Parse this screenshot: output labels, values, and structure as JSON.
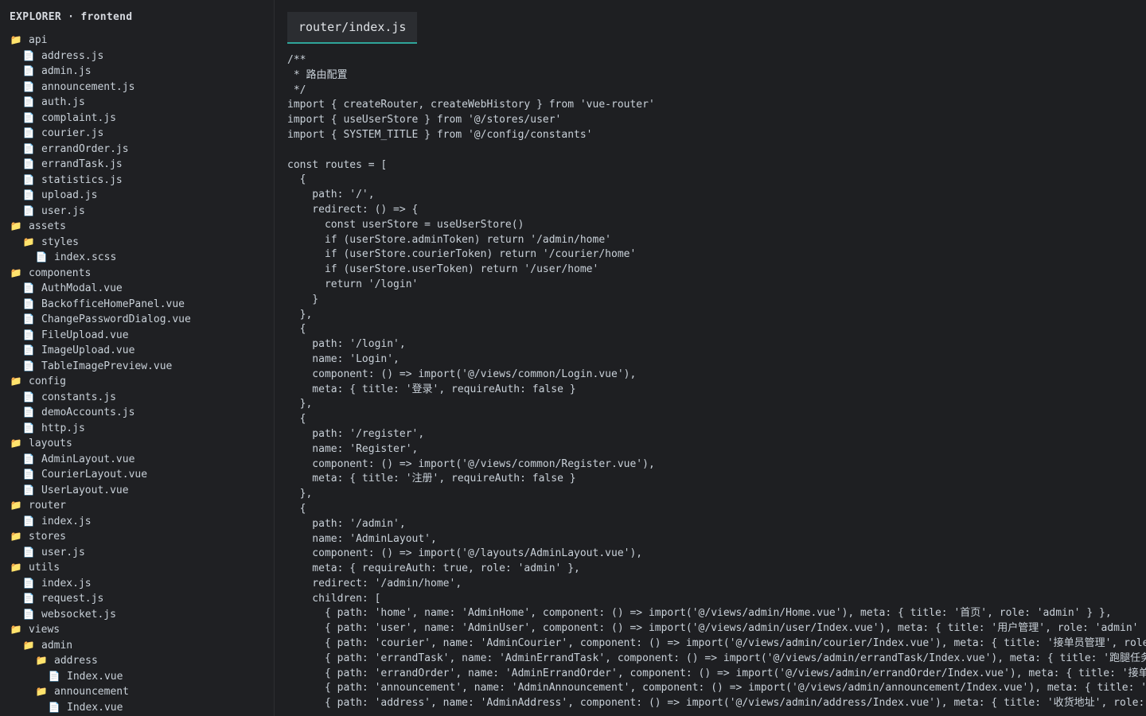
{
  "sidebar": {
    "title": "EXPLORER · frontend",
    "items": [
      {
        "label": "api",
        "type": "folder",
        "depth": 0
      },
      {
        "label": "address.js",
        "type": "file",
        "depth": 1
      },
      {
        "label": "admin.js",
        "type": "file",
        "depth": 1
      },
      {
        "label": "announcement.js",
        "type": "file",
        "depth": 1
      },
      {
        "label": "auth.js",
        "type": "file",
        "depth": 1
      },
      {
        "label": "complaint.js",
        "type": "file",
        "depth": 1
      },
      {
        "label": "courier.js",
        "type": "file",
        "depth": 1
      },
      {
        "label": "errandOrder.js",
        "type": "file",
        "depth": 1
      },
      {
        "label": "errandTask.js",
        "type": "file",
        "depth": 1
      },
      {
        "label": "statistics.js",
        "type": "file",
        "depth": 1
      },
      {
        "label": "upload.js",
        "type": "file",
        "depth": 1
      },
      {
        "label": "user.js",
        "type": "file",
        "depth": 1
      },
      {
        "label": "assets",
        "type": "folder",
        "depth": 0
      },
      {
        "label": "styles",
        "type": "folder",
        "depth": 1
      },
      {
        "label": "index.scss",
        "type": "file",
        "depth": 2
      },
      {
        "label": "components",
        "type": "folder",
        "depth": 0
      },
      {
        "label": "AuthModal.vue",
        "type": "file",
        "depth": 1
      },
      {
        "label": "BackofficeHomePanel.vue",
        "type": "file",
        "depth": 1
      },
      {
        "label": "ChangePasswordDialog.vue",
        "type": "file",
        "depth": 1
      },
      {
        "label": "FileUpload.vue",
        "type": "file",
        "depth": 1
      },
      {
        "label": "ImageUpload.vue",
        "type": "file",
        "depth": 1
      },
      {
        "label": "TableImagePreview.vue",
        "type": "file",
        "depth": 1
      },
      {
        "label": "config",
        "type": "folder",
        "depth": 0
      },
      {
        "label": "constants.js",
        "type": "file",
        "depth": 1
      },
      {
        "label": "demoAccounts.js",
        "type": "file",
        "depth": 1
      },
      {
        "label": "http.js",
        "type": "file",
        "depth": 1
      },
      {
        "label": "layouts",
        "type": "folder",
        "depth": 0
      },
      {
        "label": "AdminLayout.vue",
        "type": "file",
        "depth": 1
      },
      {
        "label": "CourierLayout.vue",
        "type": "file",
        "depth": 1
      },
      {
        "label": "UserLayout.vue",
        "type": "file",
        "depth": 1
      },
      {
        "label": "router",
        "type": "folder",
        "depth": 0
      },
      {
        "label": "index.js",
        "type": "file",
        "depth": 1
      },
      {
        "label": "stores",
        "type": "folder",
        "depth": 0
      },
      {
        "label": "user.js",
        "type": "file",
        "depth": 1
      },
      {
        "label": "utils",
        "type": "folder",
        "depth": 0
      },
      {
        "label": "index.js",
        "type": "file",
        "depth": 1
      },
      {
        "label": "request.js",
        "type": "file",
        "depth": 1
      },
      {
        "label": "websocket.js",
        "type": "file",
        "depth": 1
      },
      {
        "label": "views",
        "type": "folder",
        "depth": 0
      },
      {
        "label": "admin",
        "type": "folder",
        "depth": 1
      },
      {
        "label": "address",
        "type": "folder",
        "depth": 2
      },
      {
        "label": "Index.vue",
        "type": "file",
        "depth": 3
      },
      {
        "label": "announcement",
        "type": "folder",
        "depth": 2
      },
      {
        "label": "Index.vue",
        "type": "file",
        "depth": 3
      }
    ]
  },
  "icons": {
    "folder": "folder-icon",
    "file": "file-icon"
  },
  "colors": {
    "folder": "#e2b34a",
    "tab_accent": "#2fa59a",
    "background": "#1e1f22"
  },
  "editor": {
    "tab_label": "router/index.js",
    "lines": [
      "/**",
      " * 路由配置",
      " */",
      "import { createRouter, createWebHistory } from 'vue-router'",
      "import { useUserStore } from '@/stores/user'",
      "import { SYSTEM_TITLE } from '@/config/constants'",
      "",
      "const routes = [",
      "  {",
      "    path: '/',",
      "    redirect: () => {",
      "      const userStore = useUserStore()",
      "      if (userStore.adminToken) return '/admin/home'",
      "      if (userStore.courierToken) return '/courier/home'",
      "      if (userStore.userToken) return '/user/home'",
      "      return '/login'",
      "    }",
      "  },",
      "  {",
      "    path: '/login',",
      "    name: 'Login',",
      "    component: () => import('@/views/common/Login.vue'),",
      "    meta: { title: '登录', requireAuth: false }",
      "  },",
      "  {",
      "    path: '/register',",
      "    name: 'Register',",
      "    component: () => import('@/views/common/Register.vue'),",
      "    meta: { title: '注册', requireAuth: false }",
      "  },",
      "  {",
      "    path: '/admin',",
      "    name: 'AdminLayout',",
      "    component: () => import('@/layouts/AdminLayout.vue'),",
      "    meta: { requireAuth: true, role: 'admin' },",
      "    redirect: '/admin/home',",
      "    children: [",
      "      { path: 'home', name: 'AdminHome', component: () => import('@/views/admin/Home.vue'), meta: { title: '首页', role: 'admin' } },",
      "      { path: 'user', name: 'AdminUser', component: () => import('@/views/admin/user/Index.vue'), meta: { title: '用户管理', role: 'admin'",
      "      { path: 'courier', name: 'AdminCourier', component: () => import('@/views/admin/courier/Index.vue'), meta: { title: '接单员管理', role",
      "      { path: 'errandTask', name: 'AdminErrandTask', component: () => import('@/views/admin/errandTask/Index.vue'), meta: { title: '跑腿任务",
      "      { path: 'errandOrder', name: 'AdminErrandOrder', component: () => import('@/views/admin/errandOrder/Index.vue'), meta: { title: '接单",
      "      { path: 'announcement', name: 'AdminAnnouncement', component: () => import('@/views/admin/announcement/Index.vue'), meta: { title: '",
      "      { path: 'address', name: 'AdminAddress', component: () => import('@/views/admin/address/Index.vue'), meta: { title: '收货地址', role:"
    ]
  }
}
